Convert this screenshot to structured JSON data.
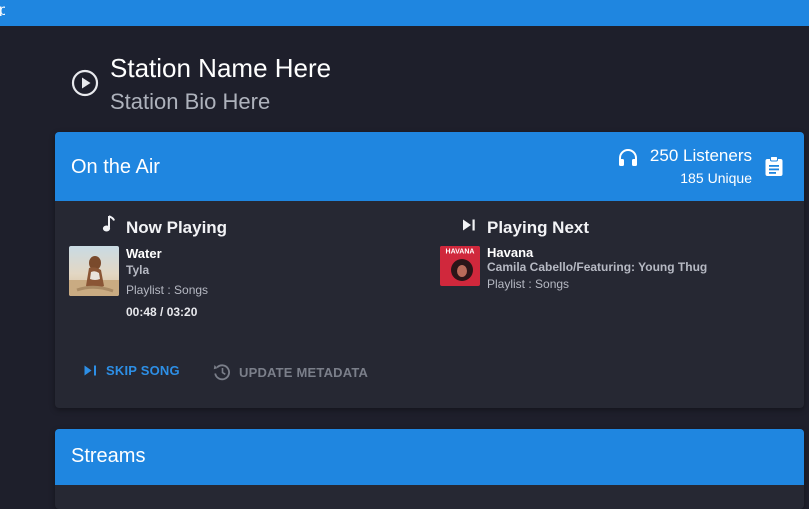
{
  "topbar": {
    "glyph": "p"
  },
  "station": {
    "name": "Station Name Here",
    "bio": "Station Bio Here"
  },
  "on_air": {
    "title": "On the Air",
    "listeners_total": "250 Listeners",
    "listeners_unique_count": "185",
    "listeners_unique_label": "Unique",
    "now_playing": {
      "label": "Now Playing",
      "title": "Water",
      "artist": "Tyla",
      "playlist": "Playlist : Songs",
      "time": "00:48 / 03:20"
    },
    "playing_next": {
      "label": "Playing Next",
      "title": "Havana",
      "artist": "Camila Cabello/Featuring: Young Thug",
      "playlist": "Playlist : Songs",
      "art_text": "HAVANA"
    },
    "skip_label": "SKIP SONG",
    "update_label": "UPDATE METADATA"
  },
  "streams": {
    "title": "Streams"
  },
  "colors": {
    "accent": "#1f86e0",
    "background": "#1e1f2b",
    "card": "#262833",
    "link": "#2d8fe6"
  },
  "icons": [
    "play-circle-icon",
    "headphones-icon",
    "clipboard-icon",
    "music-note-icon",
    "skip-next-icon",
    "history-icon"
  ]
}
